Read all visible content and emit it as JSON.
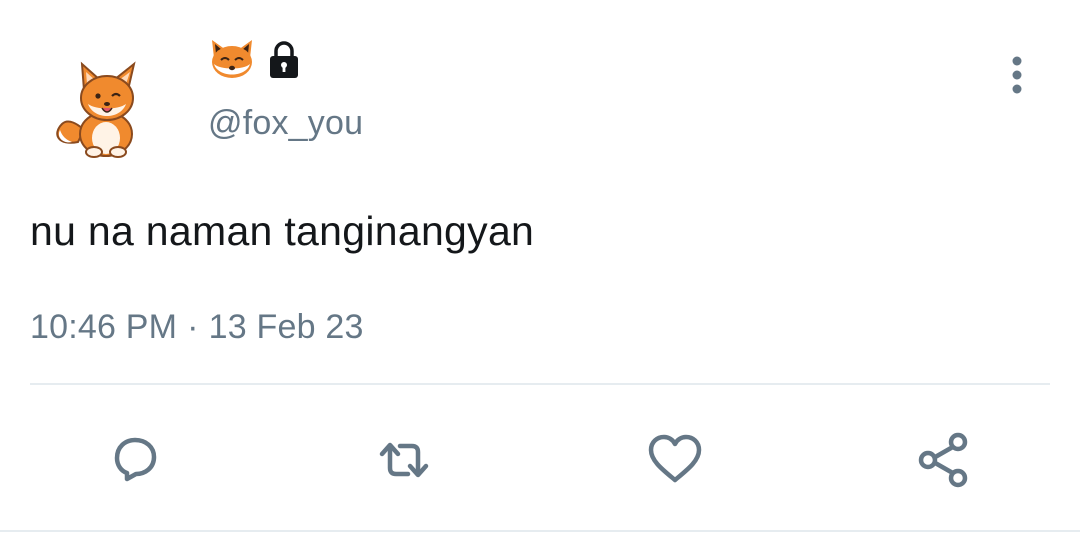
{
  "tweet": {
    "handle": "@fox_you",
    "text": "nu na naman tanginangyan",
    "time": "10:46 PM",
    "separator": "·",
    "date": "13 Feb 23"
  },
  "icons": {
    "avatar": "fox-avatar",
    "name_emoji": "fox-face-emoji",
    "protected": "lock-icon",
    "more": "more-vertical-icon",
    "actions": [
      "reply-icon",
      "retweet-icon",
      "like-icon",
      "share-icon"
    ]
  },
  "colors": {
    "icon_gray": "#657786",
    "text": "#14171a",
    "fox_orange": "#f08a2e",
    "divider": "#e6ecf0"
  }
}
